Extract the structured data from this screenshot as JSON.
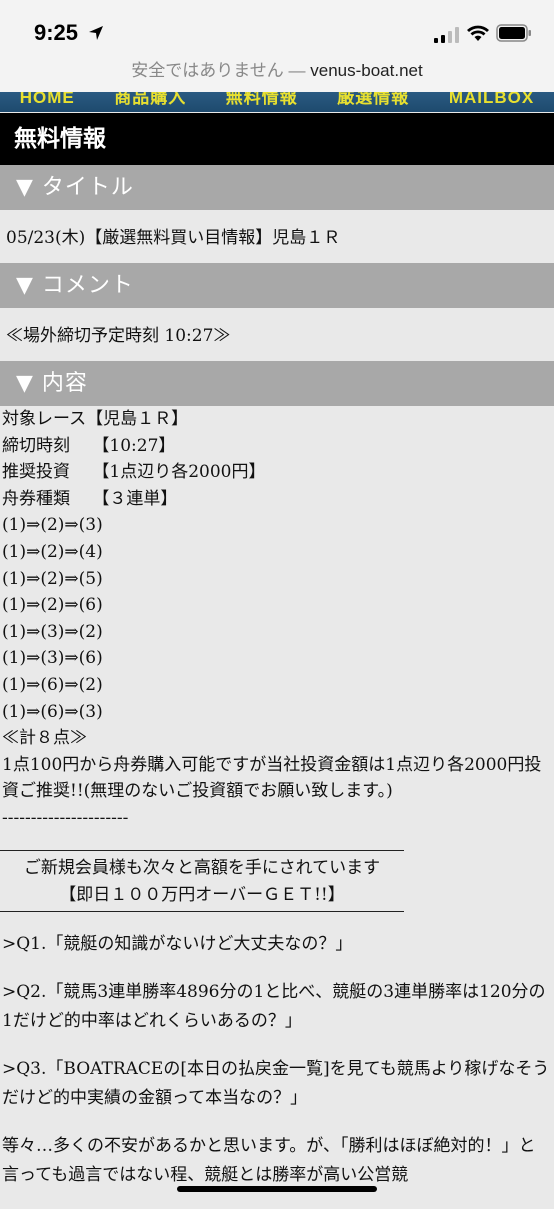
{
  "status_bar": {
    "time": "9:25"
  },
  "url_bar": {
    "security_text": "安全ではありません — ",
    "host": "venus-boat.net"
  },
  "nav": {
    "items": [
      "HOME",
      "商品購入",
      "無料情報",
      "厳選情報",
      "MAILBOX"
    ]
  },
  "header": {
    "title": "無料情報"
  },
  "sections": {
    "title": {
      "label": "▼ タイトル",
      "text": "05/23(木)【厳選無料買い目情報】児島１Ｒ"
    },
    "comment": {
      "label": "▼ コメント",
      "text": "≪場外締切予定時刻 10:27≫"
    },
    "content": {
      "label": "▼ 内容"
    }
  },
  "content": {
    "lines": [
      "対象レース【児島１Ｒ】",
      "締切時刻　 【10:27】",
      "推奨投資　 【1点辺り各2000円】",
      "舟券種類　 【３連単】",
      "(1)⇒(2)⇒(3)",
      "(1)⇒(2)⇒(4)",
      "(1)⇒(2)⇒(5)",
      "(1)⇒(2)⇒(6)",
      "(1)⇒(3)⇒(2)",
      "(1)⇒(3)⇒(6)",
      "(1)⇒(6)⇒(2)",
      "(1)⇒(6)⇒(3)",
      "≪計８点≫"
    ],
    "note": "1点100円から舟券購入可能ですが当社投資金額は1点辺り各2000円投資ご推奨!!(無理のないご投資額でお願い致します。)",
    "divider": "----------------------"
  },
  "notice": {
    "line1": "ご新規会員様も次々と高額を手にされています",
    "line2": "【即日１００万円オーバーＧＥＴ!!】"
  },
  "qa": {
    "q1": ">Q1.「競艇の知識がないけど大丈夫なの？」",
    "q2": ">Q2.「競馬3連単勝率4896分の1と比べ、競艇の3連単勝率は120分の1だけど的中率はどれくらいあるの？」",
    "q3": ">Q3.「BOATRACEの[本日の払戻金一覧]を見ても競馬より稼げなそうだけど的中実績の金額って本当なの？」",
    "closing": "等々…多くの不安があるかと思います。が、「勝利はほぼ絶対的！」と言っても過言ではない程、競艇とは勝率が高い公営競"
  },
  "colors": {
    "header_bg": "#000000",
    "section_bar": "#a8a8a8",
    "page_bg": "#e9e9e9",
    "nav_text": "#e8e030"
  }
}
